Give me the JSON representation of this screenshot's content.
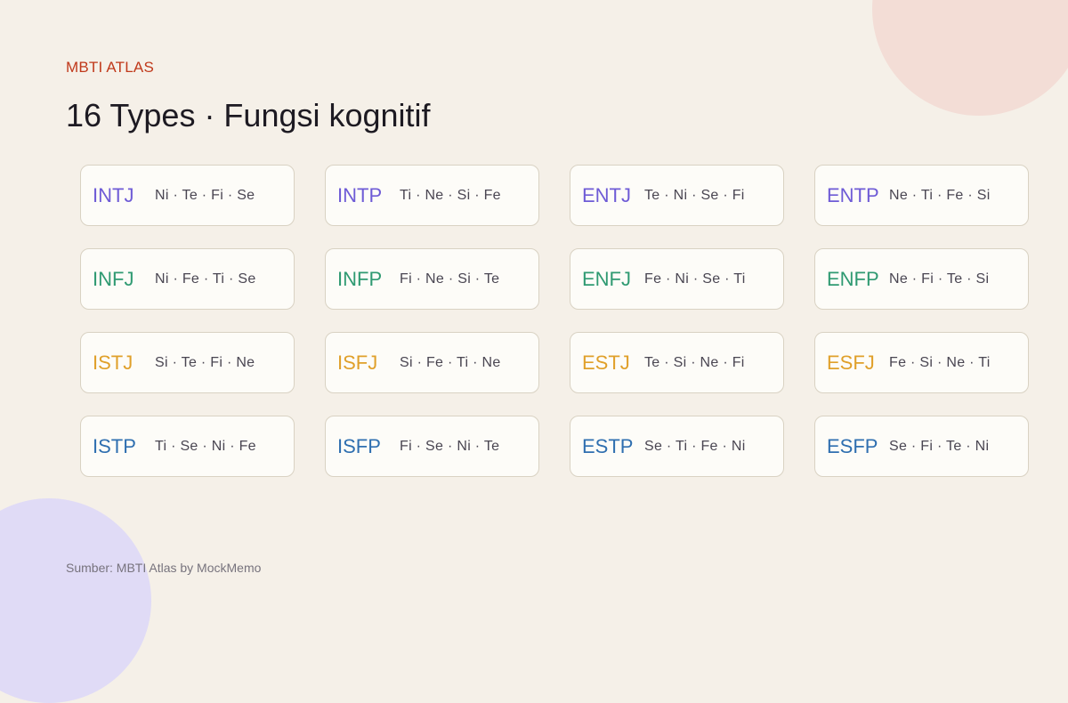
{
  "header": {
    "kicker": "MBTI ATLAS",
    "title": "16 Types · Fungsi kognitif"
  },
  "colors": {
    "accent": "#c0391b",
    "analyst": "#6e5bd6",
    "diplomat": "#2f9a72",
    "sentinel": "#e0a02a",
    "explorer": "#2f6fb0"
  },
  "types": [
    {
      "code": "INTJ",
      "functions": "Ni · Te · Fi · Se",
      "group": "analyst"
    },
    {
      "code": "INTP",
      "functions": "Ti · Ne · Si · Fe",
      "group": "analyst"
    },
    {
      "code": "ENTJ",
      "functions": "Te · Ni · Se · Fi",
      "group": "analyst"
    },
    {
      "code": "ENTP",
      "functions": "Ne · Ti · Fe · Si",
      "group": "analyst"
    },
    {
      "code": "INFJ",
      "functions": "Ni · Fe · Ti · Se",
      "group": "diplomat"
    },
    {
      "code": "INFP",
      "functions": "Fi · Ne · Si · Te",
      "group": "diplomat"
    },
    {
      "code": "ENFJ",
      "functions": "Fe · Ni · Se · Ti",
      "group": "diplomat"
    },
    {
      "code": "ENFP",
      "functions": "Ne · Fi · Te · Si",
      "group": "diplomat"
    },
    {
      "code": "ISTJ",
      "functions": "Si · Te · Fi · Ne",
      "group": "sentinel"
    },
    {
      "code": "ISFJ",
      "functions": "Si · Fe · Ti · Ne",
      "group": "sentinel"
    },
    {
      "code": "ESTJ",
      "functions": "Te · Si · Ne · Fi",
      "group": "sentinel"
    },
    {
      "code": "ESFJ",
      "functions": "Fe · Si · Ne · Ti",
      "group": "sentinel"
    },
    {
      "code": "ISTP",
      "functions": "Ti · Se · Ni · Fe",
      "group": "explorer"
    },
    {
      "code": "ISFP",
      "functions": "Fi · Se · Ni · Te",
      "group": "explorer"
    },
    {
      "code": "ESTP",
      "functions": "Se · Ti · Fe · Ni",
      "group": "explorer"
    },
    {
      "code": "ESFP",
      "functions": "Se · Fi · Te · Ni",
      "group": "explorer"
    }
  ],
  "footer": {
    "source": "Sumber: MBTI Atlas by MockMemo"
  }
}
